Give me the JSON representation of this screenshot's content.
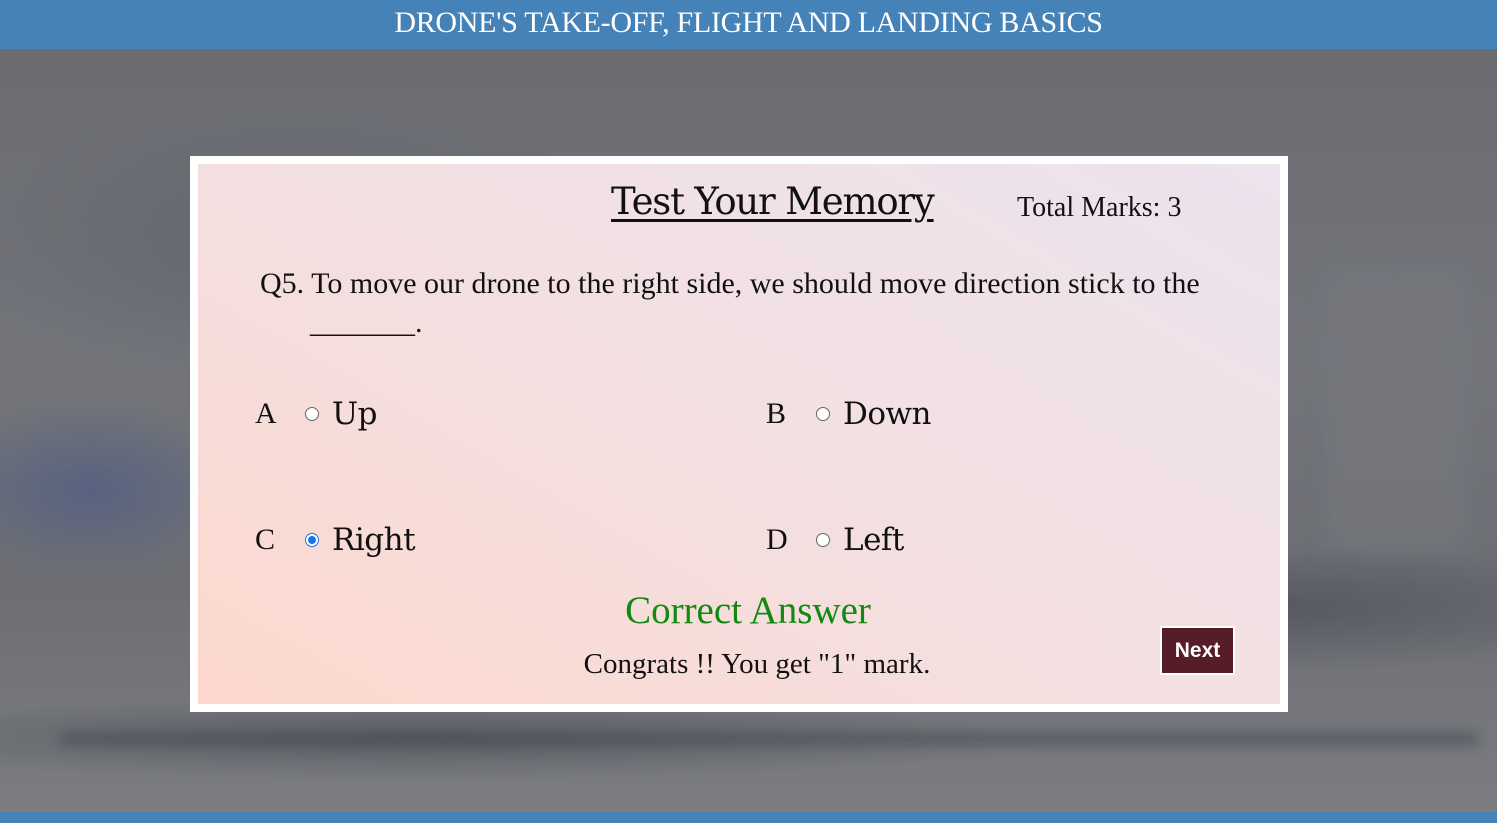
{
  "header": {
    "title": "DRONE'S TAKE-OFF, FLIGHT AND LANDING BASICS"
  },
  "quiz": {
    "title": "Test Your Memory",
    "total_marks": "Total Marks: 3",
    "question": "Q5. To move our drone to the right side, we should move direction stick to the _______.",
    "options": [
      {
        "letter": "A",
        "text": "Up",
        "selected": false
      },
      {
        "letter": "B",
        "text": "Down",
        "selected": false
      },
      {
        "letter": "C",
        "text": "Right",
        "selected": true
      },
      {
        "letter": "D",
        "text": "Left",
        "selected": false
      }
    ],
    "result_title": "Correct Answer",
    "result_message": "Congrats !! You get \"1\" mark.",
    "next_label": "Next"
  },
  "colors": {
    "header_bg": "#4582b8",
    "correct_text": "#128a12",
    "next_button_bg": "#561c27",
    "radio_selected": "#1a73e8"
  }
}
